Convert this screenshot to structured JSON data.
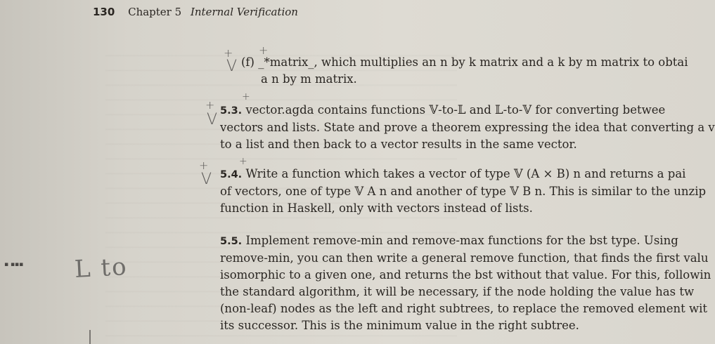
{
  "header": {
    "page_number": "130",
    "chapter": "Chapter 5",
    "chapter_title": "Internal Verification"
  },
  "item_f": {
    "line1": "(f) _*matrix_, which multiplies an n by k matrix and a k by m matrix to obtai",
    "line2": "a n by m matrix."
  },
  "ex_5_3": {
    "number": "5.3.",
    "line1": "vector.agda contains functions 𝕍-to-𝕃 and 𝕃-to-𝕍 for converting betwee",
    "line2": "vectors and lists. State and prove a theorem expressing the idea that converting a vecto",
    "line3": "to a list and then back to a vector results in the same vector."
  },
  "ex_5_4": {
    "number": "5.4.",
    "line1": "Write a function which takes a vector of type 𝕍 (A × B) n and returns a pai",
    "line2": "of vectors, one of type 𝕍 A n and another of type 𝕍 B n. This is similar to the unzip",
    "line3": "function in Haskell, only with vectors instead of lists."
  },
  "ex_5_5": {
    "number": "5.5.",
    "line1": "Implement remove-min and remove-max functions for the bst type. Using",
    "line2": "remove-min, you can then write a general remove function, that finds the first valu",
    "line3": "isomorphic to a given one, and returns the bst without that value. For this, followin",
    "line4": "the standard algorithm, it will be necessary, if the node holding the value has tw",
    "line5": "(non-leaf) nodes as the left and right subtrees, to replace the removed element wit",
    "line6": "its successor. This is the minimum value in the right subtree."
  },
  "annotations": {
    "margin_scribble": "L to",
    "plus_mark": "+",
    "check_mark": "V"
  }
}
